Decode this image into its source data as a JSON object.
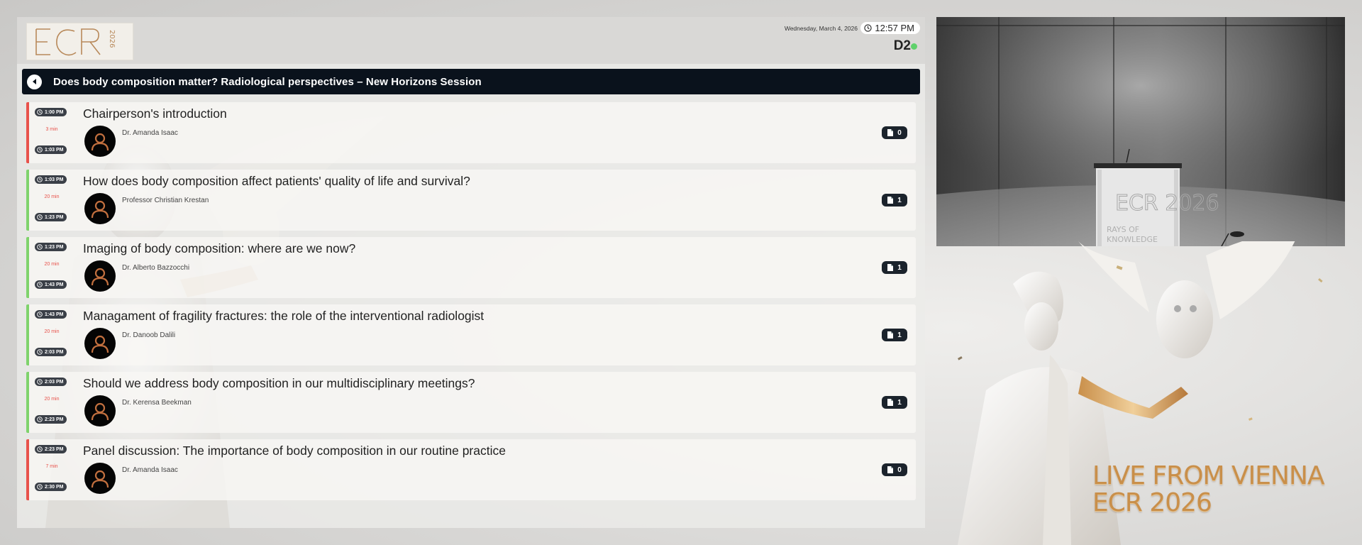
{
  "header": {
    "logo_text": "ECR 2026",
    "date": "Wednesday, March 4, 2026",
    "time": "12:57 PM",
    "room": "D2"
  },
  "session": {
    "title": "Does body composition matter? Radiological perspectives – New Horizons Session"
  },
  "talks": [
    {
      "start": "1:00 PM",
      "end": "1:03 PM",
      "duration": "3 min",
      "title": "Chairperson's introduction",
      "speaker": "Dr. Amanda Isaac",
      "docs": "0",
      "status": "red"
    },
    {
      "start": "1:03 PM",
      "end": "1:23 PM",
      "duration": "20 min",
      "title": "How does body composition affect patients' quality of life and survival?",
      "speaker": "Professor Christian Krestan",
      "docs": "1",
      "status": "green"
    },
    {
      "start": "1:23 PM",
      "end": "1:43 PM",
      "duration": "20 min",
      "title": "Imaging of body composition: where are we now?",
      "speaker": "Dr. Alberto Bazzocchi",
      "docs": "1",
      "status": "green"
    },
    {
      "start": "1:43 PM",
      "end": "2:03 PM",
      "duration": "20 min",
      "title": "Managament of fragility fractures: the role of the interventional radiologist",
      "speaker": "Dr. Danoob Dalili",
      "docs": "1",
      "status": "green"
    },
    {
      "start": "2:03 PM",
      "end": "2:23 PM",
      "duration": "20 min",
      "title": "Should we address body composition in our multidisciplinary meetings?",
      "speaker": "Dr. Kerensa Beekman",
      "docs": "1",
      "status": "green"
    },
    {
      "start": "2:23 PM",
      "end": "2:30 PM",
      "duration": "7 min",
      "title": "Panel discussion: The importance of body composition in our routine practice",
      "speaker": "Dr. Amanda Isaac",
      "docs": "0",
      "status": "red"
    }
  ],
  "video": {
    "podium_logo": "ECR 2026",
    "podium_tagline_1": "RAYS OF",
    "podium_tagline_2": "KNOWLEDGE"
  },
  "branding": {
    "line1": "LIVE FROM VIENNA",
    "line2": "ECR 2026"
  },
  "colors": {
    "header_bg": "#0a121c",
    "status_red": "#e8524b",
    "status_green": "#7fd36c",
    "live_dot": "#5fd16b",
    "gold": "#c98f4a"
  },
  "icons": [
    "clock-icon",
    "back-arrow-icon",
    "user-avatar-icon",
    "document-icon"
  ]
}
